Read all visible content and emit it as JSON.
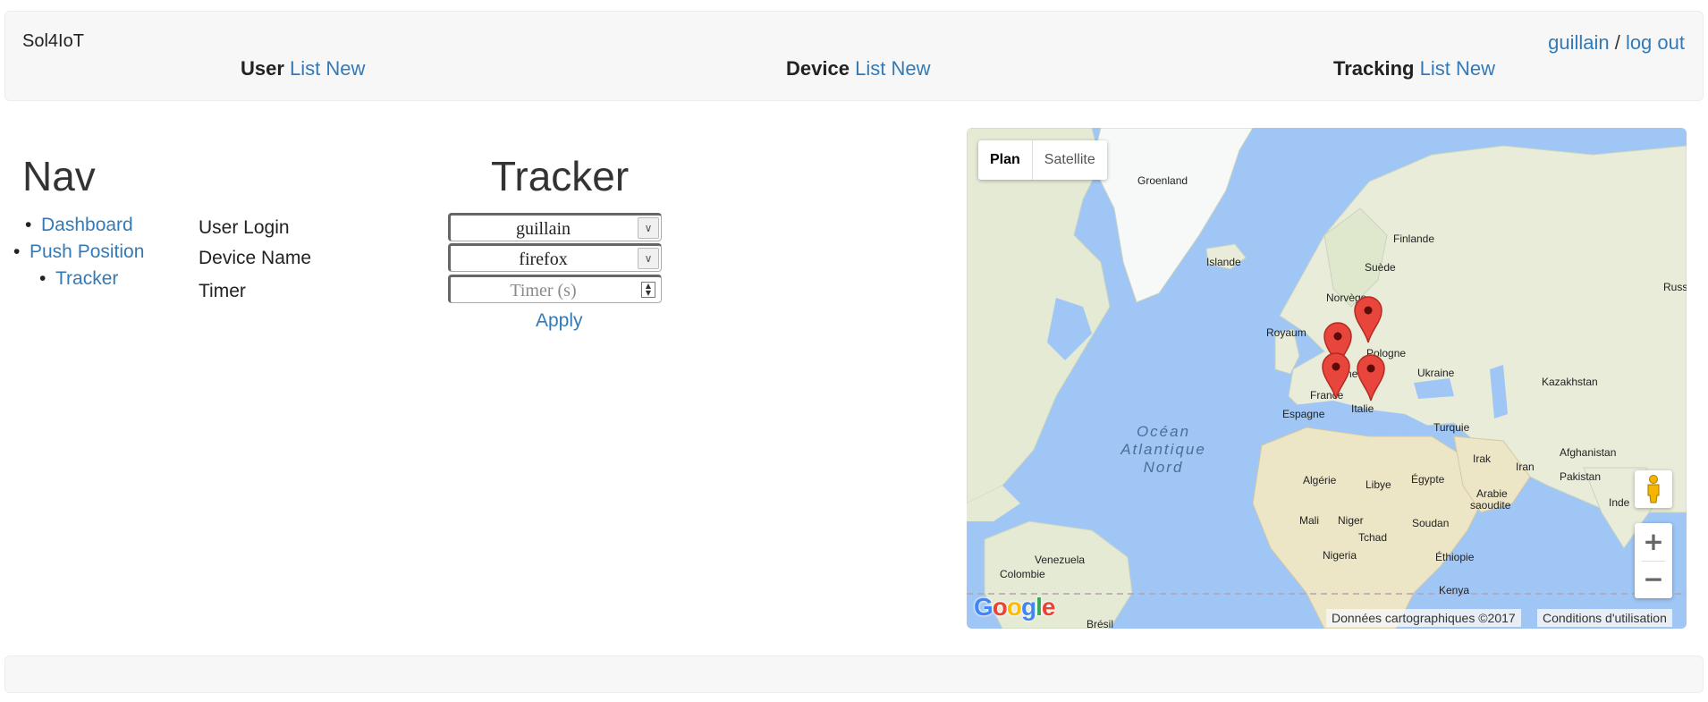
{
  "header": {
    "brand": "Sol4IoT",
    "username": "guillain",
    "separator": " / ",
    "logout": "log out",
    "groups": [
      {
        "title": "User",
        "list": "List",
        "new": "New"
      },
      {
        "title": "Device",
        "list": "List",
        "new": "New"
      },
      {
        "title": "Tracking",
        "list": "List",
        "new": "New"
      }
    ]
  },
  "nav": {
    "title": "Nav",
    "items": [
      {
        "label": "Dashboard"
      },
      {
        "label": "Push Position"
      },
      {
        "label": "Tracker"
      }
    ]
  },
  "tracker": {
    "title": "Tracker",
    "user_login_label": "User Login",
    "user_login_value": "guillain",
    "device_name_label": "Device Name",
    "device_name_value": "firefox",
    "timer_label": "Timer",
    "timer_placeholder": "Timer (s)",
    "apply_label": "Apply"
  },
  "map": {
    "type_plan": "Plan",
    "type_satellite": "Satellite",
    "zoom_in": "+",
    "zoom_out": "−",
    "attribution": "Données cartographiques ©2017",
    "terms": "Conditions d'utilisation",
    "logo_letters": [
      "G",
      "o",
      "o",
      "g",
      "l",
      "e"
    ],
    "labels": {
      "groenland": "Groenland",
      "islande": "Islande",
      "finlande": "Finlande",
      "suede": "Suède",
      "norvege": "Norvège",
      "russ": "Russ",
      "royaume": "Royaum",
      "pologne": "Pologne",
      "allemagne": "lle   gne",
      "ukraine": "Ukraine",
      "france": "France",
      "kazakhstan": "Kazakhstan",
      "italie": "Italie",
      "espagne": "Espagne",
      "turquie": "Turquie",
      "ocean_1": "Océan",
      "ocean_2": "Atlantique",
      "ocean_3": "Nord",
      "irak": "Irak",
      "iran": "Iran",
      "afghanistan": "Afghanistan",
      "algerie": "Algérie",
      "libye": "Libye",
      "egypte": "Égypte",
      "pakistan": "Pakistan",
      "arabie": "Arabie",
      "saoudite": "saoudite",
      "inde": "Inde",
      "mali": "Mali",
      "niger": "Niger",
      "soudan": "Soudan",
      "tchad": "Tchad",
      "nigeria": "Nigeria",
      "ethiopie": "Éthiopie",
      "venezuela": "Venezuela",
      "colombie": "Colombie",
      "kenya": "Kenya",
      "bresil": "Brésil"
    }
  },
  "colors": {
    "link": "#337ab7",
    "water": "#9fc6f5",
    "land": "#e8ecd8",
    "marker": "#e8453c"
  }
}
